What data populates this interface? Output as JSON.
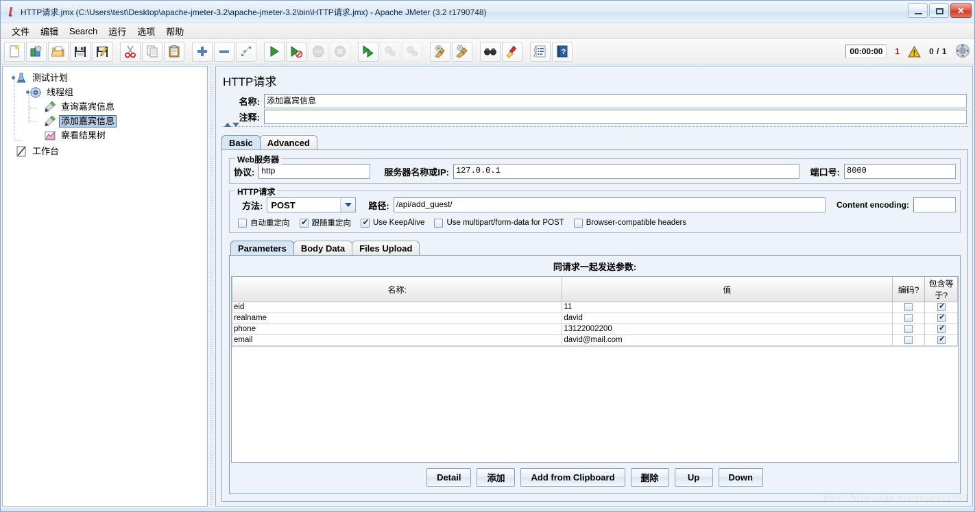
{
  "window": {
    "title": "HTTP请求.jmx (C:\\Users\\test\\Desktop\\apache-jmeter-3.2\\apache-jmeter-3.2\\bin\\HTTP请求.jmx) - Apache JMeter (3.2 r1790748)",
    "minimize_label": "–",
    "maximize_label": "□",
    "close_label": "✕"
  },
  "menu": {
    "items": [
      {
        "label": "文件"
      },
      {
        "label": "编辑"
      },
      {
        "label": "Search"
      },
      {
        "label": "运行"
      },
      {
        "label": "选项"
      },
      {
        "label": "帮助"
      }
    ]
  },
  "toolbar": {
    "buttons": [
      {
        "name": "new-icon",
        "group": 0
      },
      {
        "name": "templates-icon",
        "group": 0
      },
      {
        "name": "open-icon",
        "group": 0
      },
      {
        "name": "save-icon",
        "group": 0
      },
      {
        "name": "save-as-icon",
        "group": 0
      },
      {
        "name": "cut-icon",
        "group": 1
      },
      {
        "name": "copy-icon",
        "group": 1
      },
      {
        "name": "paste-icon",
        "group": 1
      },
      {
        "name": "expand-all-icon",
        "group": 2
      },
      {
        "name": "collapse-all-icon",
        "group": 2
      },
      {
        "name": "toggle-icon",
        "group": 2
      },
      {
        "name": "start-icon",
        "group": 3
      },
      {
        "name": "start-no-pauses-icon",
        "group": 3
      },
      {
        "name": "stop-icon",
        "group": 3
      },
      {
        "name": "shutdown-icon",
        "group": 3
      },
      {
        "name": "remote-start-all-icon",
        "group": 4
      },
      {
        "name": "remote-stop-all-icon",
        "group": 4
      },
      {
        "name": "remote-shutdown-all-icon",
        "group": 4
      },
      {
        "name": "clear-icon",
        "group": 5
      },
      {
        "name": "clear-all-icon",
        "group": 5
      },
      {
        "name": "search-icon",
        "group": 6
      },
      {
        "name": "reset-search-icon",
        "group": 6
      },
      {
        "name": "function-helper-icon",
        "group": 7
      },
      {
        "name": "help-icon",
        "group": 7
      }
    ],
    "status": {
      "timer": "00:00:00",
      "warning_count": "1",
      "thread_count": "0 / 1"
    }
  },
  "tree": {
    "nodes": [
      {
        "label": "测试计划",
        "icon": "test-plan-icon",
        "depth": 0,
        "selected": false,
        "expander": true
      },
      {
        "label": "线程组",
        "icon": "thread-group-icon",
        "depth": 1,
        "selected": false,
        "expander": true
      },
      {
        "label": "查询嘉宾信息",
        "icon": "http-sampler-icon",
        "depth": 2,
        "selected": false,
        "expander": false
      },
      {
        "label": "添加嘉宾信息",
        "icon": "http-sampler-icon",
        "depth": 2,
        "selected": true,
        "expander": false
      },
      {
        "label": "察看结果树",
        "icon": "view-results-tree-icon",
        "depth": 2,
        "selected": false,
        "expander": false
      },
      {
        "label": "工作台",
        "icon": "workbench-icon",
        "depth": 0,
        "selected": false,
        "expander": false
      }
    ]
  },
  "editor": {
    "title": "HTTP请求",
    "name_label": "名称:",
    "name_value": "添加嘉宾信息",
    "comment_label": "注释:",
    "comment_value": "",
    "tabs": [
      {
        "label": "Basic",
        "active": true
      },
      {
        "label": "Advanced",
        "active": false
      }
    ],
    "web_server": {
      "group_title": "Web服务器",
      "protocol_label": "协议:",
      "protocol_value": "http",
      "server_label": "服务器名称或IP:",
      "server_value": "127.0.0.1",
      "port_label": "端口号:",
      "port_value": "8000"
    },
    "http_request": {
      "group_title": "HTTP请求",
      "method_label": "方法:",
      "method_value": "POST",
      "path_label": "路径:",
      "path_value": "/api/add_guest/",
      "content_encoding_label": "Content encoding:",
      "content_encoding_value": "",
      "options": [
        {
          "label": "自动重定向",
          "checked": false
        },
        {
          "label": "跟随重定向",
          "checked": true
        },
        {
          "label": "Use KeepAlive",
          "checked": true
        },
        {
          "label": "Use multipart/form-data for POST",
          "checked": false
        },
        {
          "label": "Browser-compatible headers",
          "checked": false
        }
      ]
    },
    "param_tabs": [
      {
        "label": "Parameters",
        "active": true
      },
      {
        "label": "Body Data",
        "active": false
      },
      {
        "label": "Files Upload",
        "active": false
      }
    ],
    "parameters": {
      "heading": "同请求一起发送参数:",
      "columns": [
        "名称:",
        "值",
        "编码?",
        "包含等于?"
      ],
      "rows": [
        {
          "name": "eid",
          "value": "11",
          "encode": false,
          "include_equals": true
        },
        {
          "name": "realname",
          "value": "david",
          "encode": false,
          "include_equals": true
        },
        {
          "name": "phone",
          "value": "13122002200",
          "encode": false,
          "include_equals": true
        },
        {
          "name": "email",
          "value": "david@mail.com",
          "encode": false,
          "include_equals": true
        }
      ],
      "buttons": [
        {
          "label": "Detail"
        },
        {
          "label": "添加"
        },
        {
          "label": "Add from Clipboard"
        },
        {
          "label": "删除"
        },
        {
          "label": "Up"
        },
        {
          "label": "Down"
        }
      ]
    }
  },
  "watermark": "http://blog.csdn.net/zhanxz1985"
}
